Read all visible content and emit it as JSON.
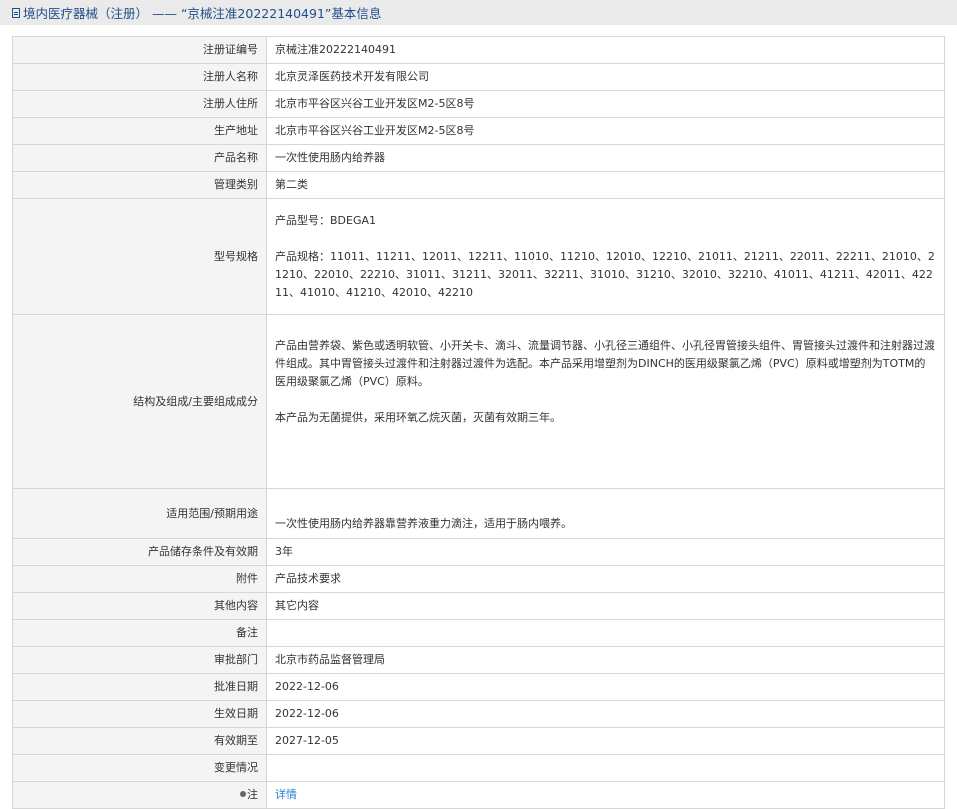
{
  "header": {
    "title": "境内医疗器械（注册） —— “京械注准20222140491”基本信息",
    "icon": "document-icon"
  },
  "rows": [
    {
      "label": "注册证编号",
      "value": "京械注准20222140491"
    },
    {
      "label": "注册人名称",
      "value": "北京灵泽医药技术开发有限公司"
    },
    {
      "label": "注册人住所",
      "value": "北京市平谷区兴谷工业开发区M2-5区8号"
    },
    {
      "label": "生产地址",
      "value": "北京市平谷区兴谷工业开发区M2-5区8号"
    },
    {
      "label": "产品名称",
      "value": "一次性使用肠内给养器"
    },
    {
      "label": "管理类别",
      "value": "第二类"
    }
  ],
  "model": {
    "label": "型号规格",
    "line1": "产品型号：BDEGA1",
    "line2": "产品规格：11011、11211、12011、12211、11010、11210、12010、12210、21011、21211、22011、22211、21010、21210、22010、22210、31011、31211、32011、32211、31010、31210、32010、32210、41011、41211、42011、42211、41010、41210、42010、42210"
  },
  "structure": {
    "label": "结构及组成/主要组成成分",
    "para1": "产品由营养袋、紫色或透明软管、小开关卡、滴斗、流量调节器、小孔径三通组件、小孔径胃管接头组件、胃管接头过渡件和注射器过渡件组成。其中胃管接头过渡件和注射器过渡件为选配。本产品采用增塑剂为DINCH的医用级聚氯乙烯（PVC）原料或增塑剂为TOTM的医用级聚氯乙烯（PVC）原料。",
    "para2": "本产品为无菌提供，采用环氧乙烷灭菌，灭菌有效期三年。"
  },
  "use": {
    "label": "适用范围/预期用途",
    "value": "一次性使用肠内给养器靠营养液重力滴注，适用于肠内喂养。"
  },
  "rows2": [
    {
      "label": "产品储存条件及有效期",
      "value": "3年"
    },
    {
      "label": "附件",
      "value": "产品技术要求"
    },
    {
      "label": "其他内容",
      "value": "其它内容"
    },
    {
      "label": "备注",
      "value": ""
    },
    {
      "label": "审批部门",
      "value": "北京市药品监督管理局"
    },
    {
      "label": "批准日期",
      "value": "2022-12-06"
    },
    {
      "label": "生效日期",
      "value": "2022-12-06"
    },
    {
      "label": "有效期至",
      "value": "2027-12-05"
    },
    {
      "label": "变更情况",
      "value": ""
    }
  ],
  "note": {
    "label": "注",
    "icon": "pin-icon",
    "link": "详情"
  },
  "colors": {
    "header_bg": "#eaeaea",
    "header_text": "#1f4e8c",
    "label_bg": "#f4f4f4",
    "link": "#2a7dd6"
  }
}
